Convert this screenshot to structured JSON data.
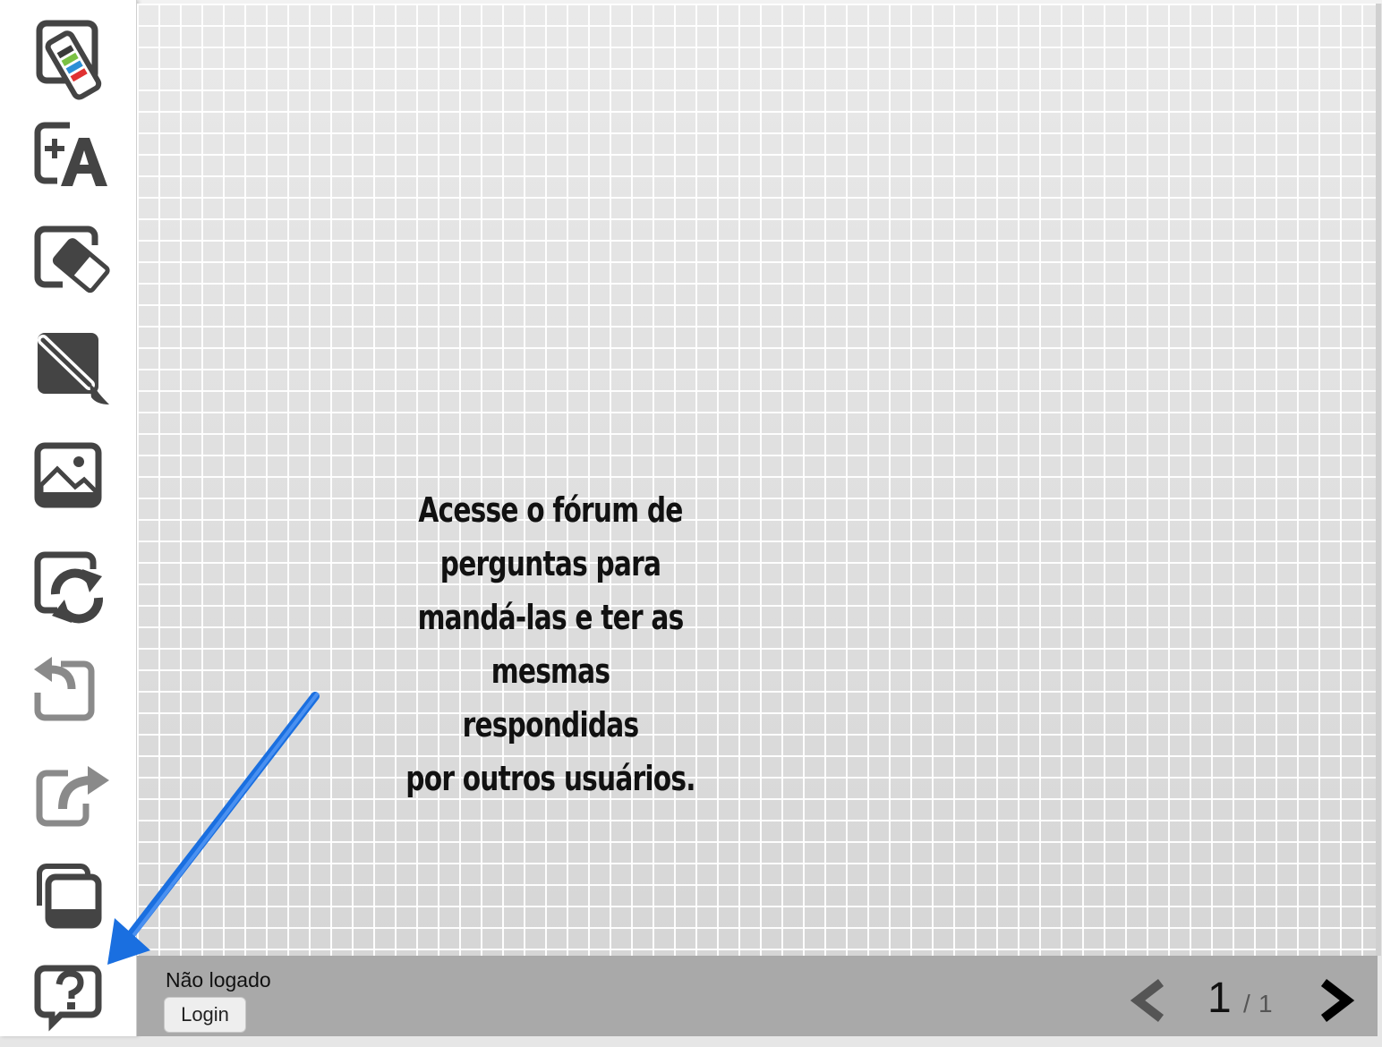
{
  "toolbar": {
    "tools": [
      {
        "name": "color-palette",
        "icon": "color-swatch-icon"
      },
      {
        "name": "add-text",
        "icon": "add-text-icon"
      },
      {
        "name": "eraser",
        "icon": "eraser-icon"
      },
      {
        "name": "brush",
        "icon": "brush-icon"
      },
      {
        "name": "image",
        "icon": "image-icon"
      },
      {
        "name": "refresh",
        "icon": "refresh-icon"
      },
      {
        "name": "undo",
        "icon": "undo-icon"
      },
      {
        "name": "redo",
        "icon": "redo-icon"
      },
      {
        "name": "pages",
        "icon": "pages-icon"
      },
      {
        "name": "help",
        "icon": "help-icon"
      }
    ]
  },
  "canvas": {
    "annotation_lines": [
      "Acesse o fórum de",
      "perguntas para",
      "mandá-las e ter as",
      "mesmas respondidas",
      "por outros usuários."
    ],
    "arrow_color": "#1a6fe0"
  },
  "footer": {
    "status": "Não logado",
    "login_label": "Login",
    "page_current": "1",
    "page_separator": "/",
    "page_total": "1",
    "prev_icon": "chevron-left-icon",
    "next_icon": "chevron-right-icon"
  }
}
